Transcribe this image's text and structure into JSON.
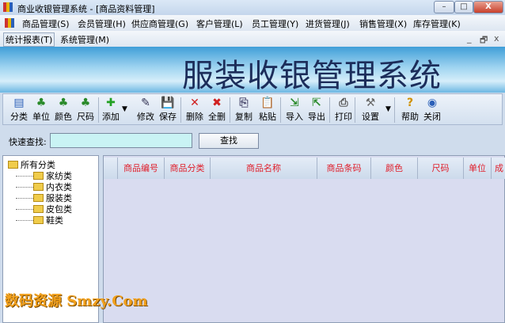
{
  "window": {
    "title": "商业收银管理系统 - [商品资料管理]",
    "minimize": "–",
    "maximize": "□",
    "close": "X"
  },
  "menu": {
    "row1": [
      "商品管理(S)",
      "会员管理(H)",
      "供应商管理(G)",
      "客户管理(L)",
      "员工管理(Y)",
      "进货管理(J)",
      "销售管理(X)",
      "库存管理(K)"
    ],
    "row2": [
      "统计报表(T)",
      "系统管理(M)"
    ],
    "mdi": [
      "_",
      "🗗",
      "x"
    ]
  },
  "banner": {
    "title": "服装收银管理系统"
  },
  "toolbar": [
    "分类",
    "单位",
    "颜色",
    "尺码",
    "添加",
    "修改",
    "保存",
    "删除",
    "全删",
    "复制",
    "粘贴",
    "导入",
    "导出",
    "打印",
    "设置",
    "帮助",
    "关闭"
  ],
  "search": {
    "label": "快速查找:",
    "value": "",
    "button": "查找"
  },
  "tree": {
    "root": "所有分类",
    "children": [
      "家纺类",
      "内衣类",
      "服装类",
      "皮包类",
      "鞋类"
    ]
  },
  "grid": {
    "columns": [
      "",
      "商品编号",
      "商品分类",
      "商品名称",
      "商品条码",
      "颜色",
      "尺码",
      "单位",
      "成"
    ]
  },
  "watermark": "数码资源 Smzy.Com",
  "colors": {
    "header_text": "#e0202c",
    "search_bg": "#c9f3f4",
    "grid_bg": "#d9dcf0"
  }
}
